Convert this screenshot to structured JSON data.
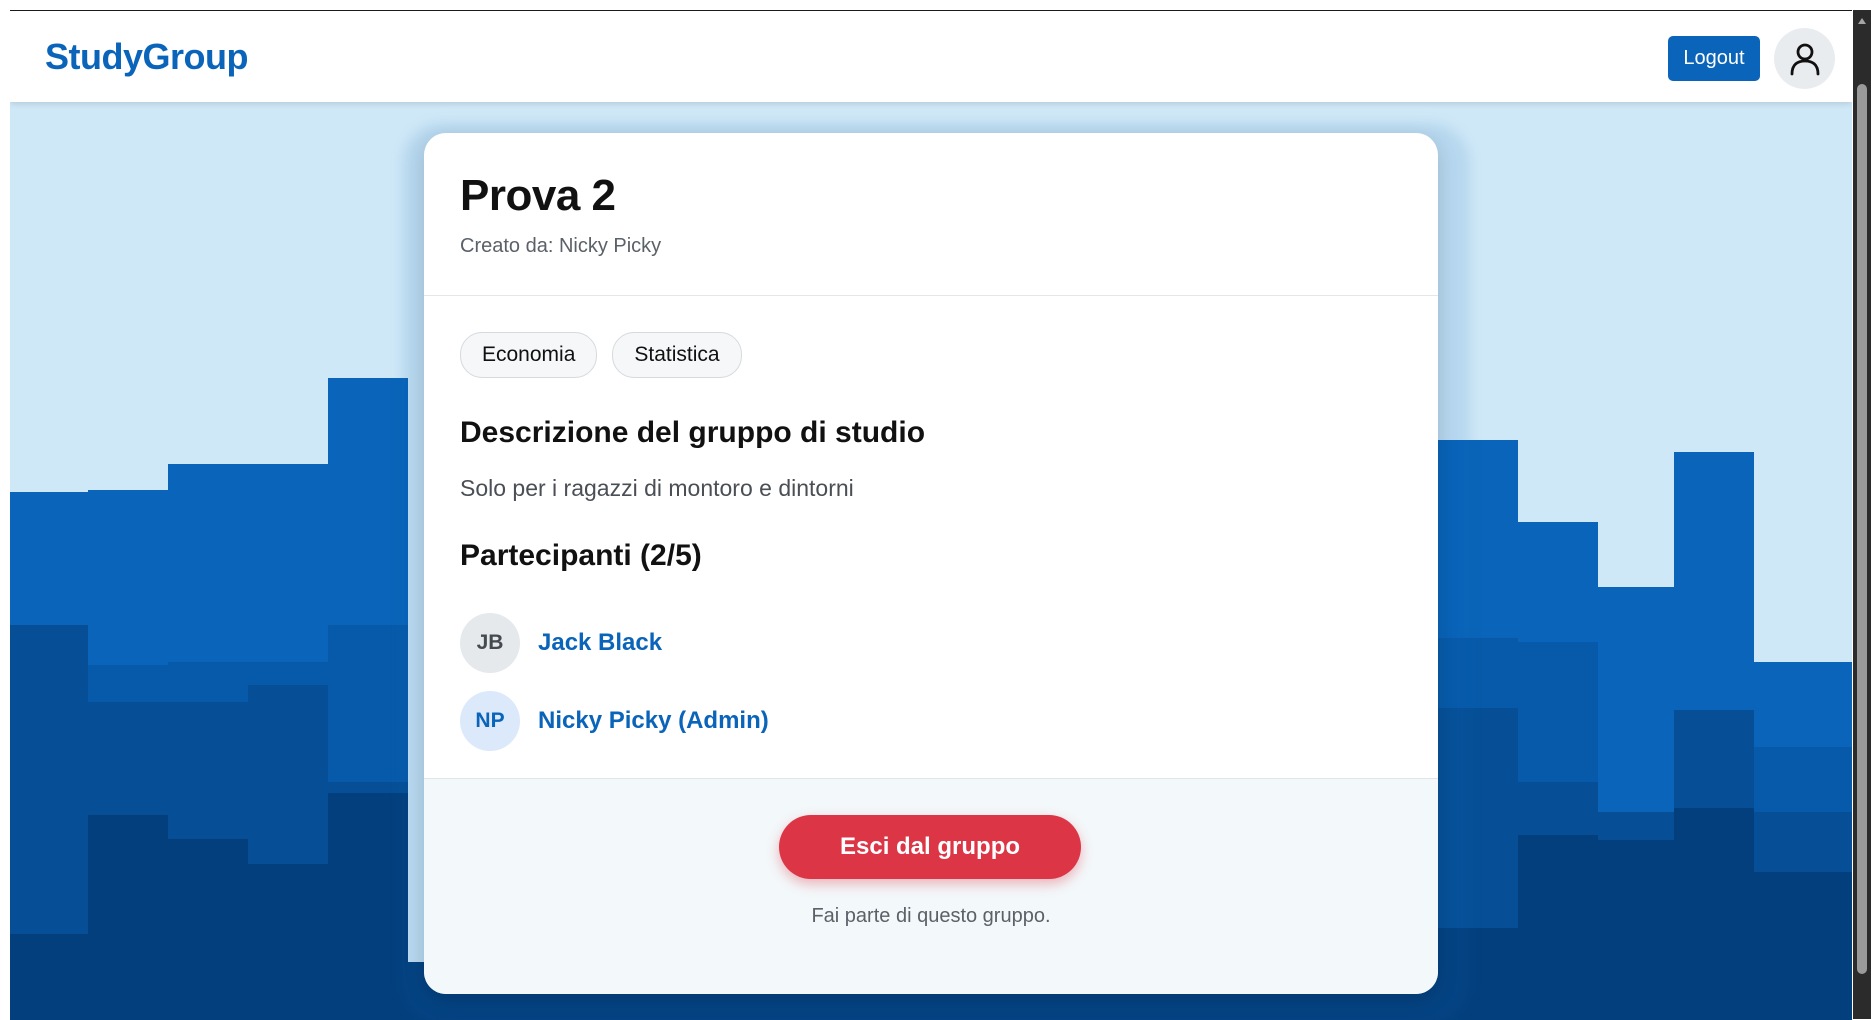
{
  "app": {
    "brand": "StudyGroup",
    "accent_color": "#0a64b9",
    "danger_color": "#dc3545"
  },
  "header": {
    "logout_label": "Logout",
    "profile_icon": "user-icon"
  },
  "group": {
    "title": "Prova 2",
    "created_by": "Creato da: Nicky Picky",
    "tags": [
      "Economia",
      "Statistica"
    ],
    "description_heading": "Descrizione del gruppo di studio",
    "description": "Solo per i ragazzi di montoro e dintorni",
    "participants_heading": "Partecipanti (2/5)",
    "participants": [
      {
        "initials": "JB",
        "name": "Jack Black"
      },
      {
        "initials": "NP",
        "name": "Nicky Picky (Admin)"
      }
    ]
  },
  "footer": {
    "leave_label": "Esci dal gruppo",
    "note": "Fai parte di questo gruppo."
  }
}
